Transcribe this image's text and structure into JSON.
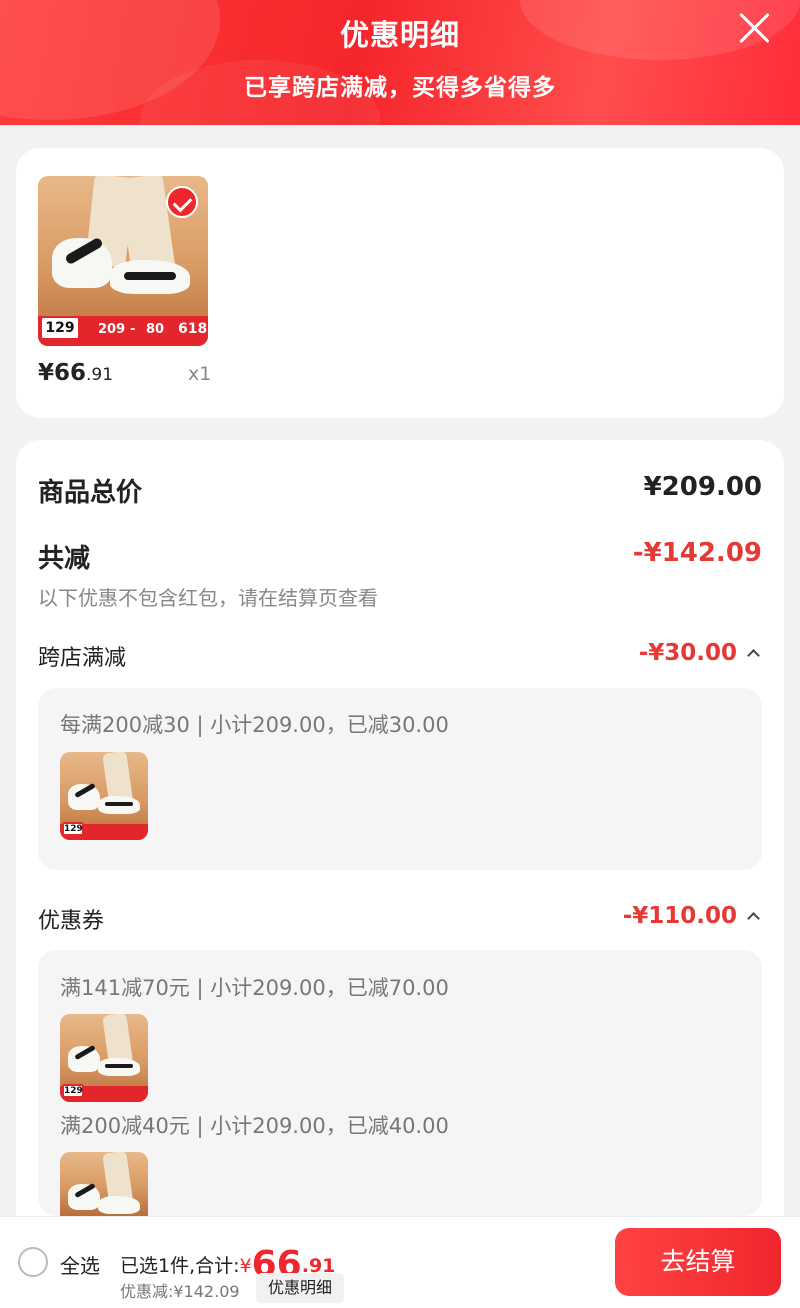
{
  "header": {
    "title": "优惠明细",
    "subtitle": "已享跨店满减，买得多省得多"
  },
  "product": {
    "price_int": "¥66",
    "price_dec": ".91",
    "qty": "x1",
    "thumb_tag": "129",
    "thumb_strip": [
      "209",
      "-",
      "80",
      "618"
    ]
  },
  "summary": {
    "total_label": "商品总价",
    "total_value": "¥209.00",
    "reduce_label": "共减",
    "reduce_value": "-¥142.09",
    "note": "以下优惠不包含红包，请在结算页查看"
  },
  "sections": [
    {
      "label": "跨店满减",
      "value": "-¥30.00",
      "rules": [
        "每满200减30 | 小计209.00，已减30.00"
      ]
    },
    {
      "label": "优惠券",
      "value": "-¥110.00",
      "rules": [
        "满141减70元 | 小计209.00，已减70.00",
        "满200减40元 | 小计209.00，已减40.00"
      ]
    }
  ],
  "bottom_bar": {
    "select_all": "全选",
    "selected_prefix": "已选1件,合计:",
    "total_yen": "¥",
    "total_int": "66",
    "total_dec": ".91",
    "discount": "优惠减:¥142.09",
    "detail_button": "优惠明细",
    "checkout_button": "去结算"
  },
  "colors": {
    "brand_red": "#f0262d",
    "discount_red": "#e53935"
  }
}
